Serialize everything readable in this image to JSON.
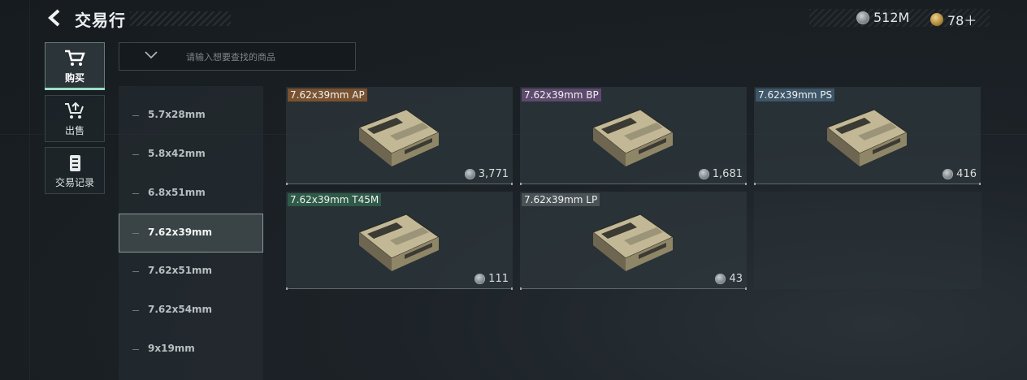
{
  "header": {
    "title": "交易行"
  },
  "currency": [
    {
      "icon": "silver-coin-icon",
      "value": "512M"
    },
    {
      "icon": "gold-coin-icon",
      "value": "78＋"
    }
  ],
  "tabs": [
    {
      "label": "购买",
      "icon": "cart-icon",
      "active": true
    },
    {
      "label": "出售",
      "icon": "sell-icon",
      "active": false
    },
    {
      "label": "交易记录",
      "icon": "record-icon",
      "active": false
    }
  ],
  "search": {
    "placeholder": "请输入想要查找的商品"
  },
  "calibers": [
    "5.7x28mm",
    "5.8x42mm",
    "6.8x51mm",
    "7.62x39mm",
    "7.62x51mm",
    "7.62x54mm",
    "9x19mm"
  ],
  "selected_caliber": "7.62x39mm",
  "items": [
    {
      "name": "7.62x39mm AP",
      "price": "3,771",
      "color": "#7a5230"
    },
    {
      "name": "7.62x39mm BP",
      "price": "1,681",
      "color": "#5e4a6e"
    },
    {
      "name": "7.62x39mm PS",
      "price": "416",
      "color": "#3d5668"
    },
    {
      "name": "7.62x39mm T45M",
      "price": "111",
      "color": "#2f5a48"
    },
    {
      "name": "7.62x39mm LP",
      "price": "43",
      "color": "#4a5256"
    }
  ]
}
